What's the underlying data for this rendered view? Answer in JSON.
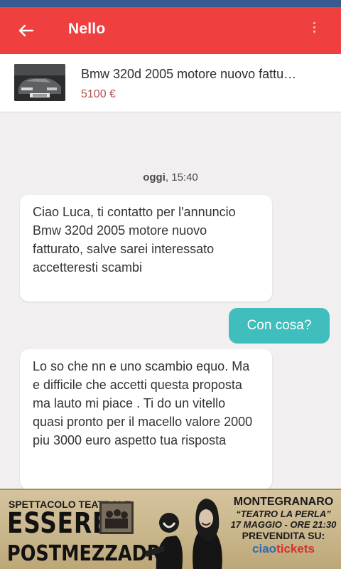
{
  "header": {
    "title": "Nello"
  },
  "listing": {
    "title": "Bmw 320d 2005 motore nuovo fattu…",
    "price": "5100 €"
  },
  "chat": {
    "date_day": "oggi",
    "date_time": ", 15:40",
    "messages": [
      {
        "from": "other",
        "text": "Ciao Luca, ti contatto per l'annuncio Bmw 320d 2005 motore nuovo fatturato, salve sarei interessato accetteresti scambi"
      },
      {
        "from": "me",
        "text": "Con cosa?"
      },
      {
        "from": "other",
        "text": "Lo so che nn e uno scambio equo. Ma e difficile che accetti questa proposta ma lauto mi piace . Ti do un vitello quasi pronto per il macello valore 2000 piu 3000 euro aspetto tua risposta"
      }
    ]
  },
  "ad": {
    "kicker": "SPETTACOLO TEATRALE",
    "title_line1": "ESSERE",
    "title_line2": "POSTMEZZADRI",
    "city": "MONTEGRANARO",
    "venue": "“TEATRO LA PERLA”",
    "when": "17 MAGGIO - ORE 21:30",
    "presale": "PREVENDITA SU:",
    "brand_part1": "ciao",
    "brand_part2": "tickets"
  },
  "colors": {
    "appbar": "#ef3f3f",
    "statusbar": "#3a5b92",
    "outgoing_bubble": "#3fbebd",
    "price": "#b25050"
  },
  "icons": {
    "back": "arrow-left-icon",
    "menu": "more-vert-icon"
  }
}
